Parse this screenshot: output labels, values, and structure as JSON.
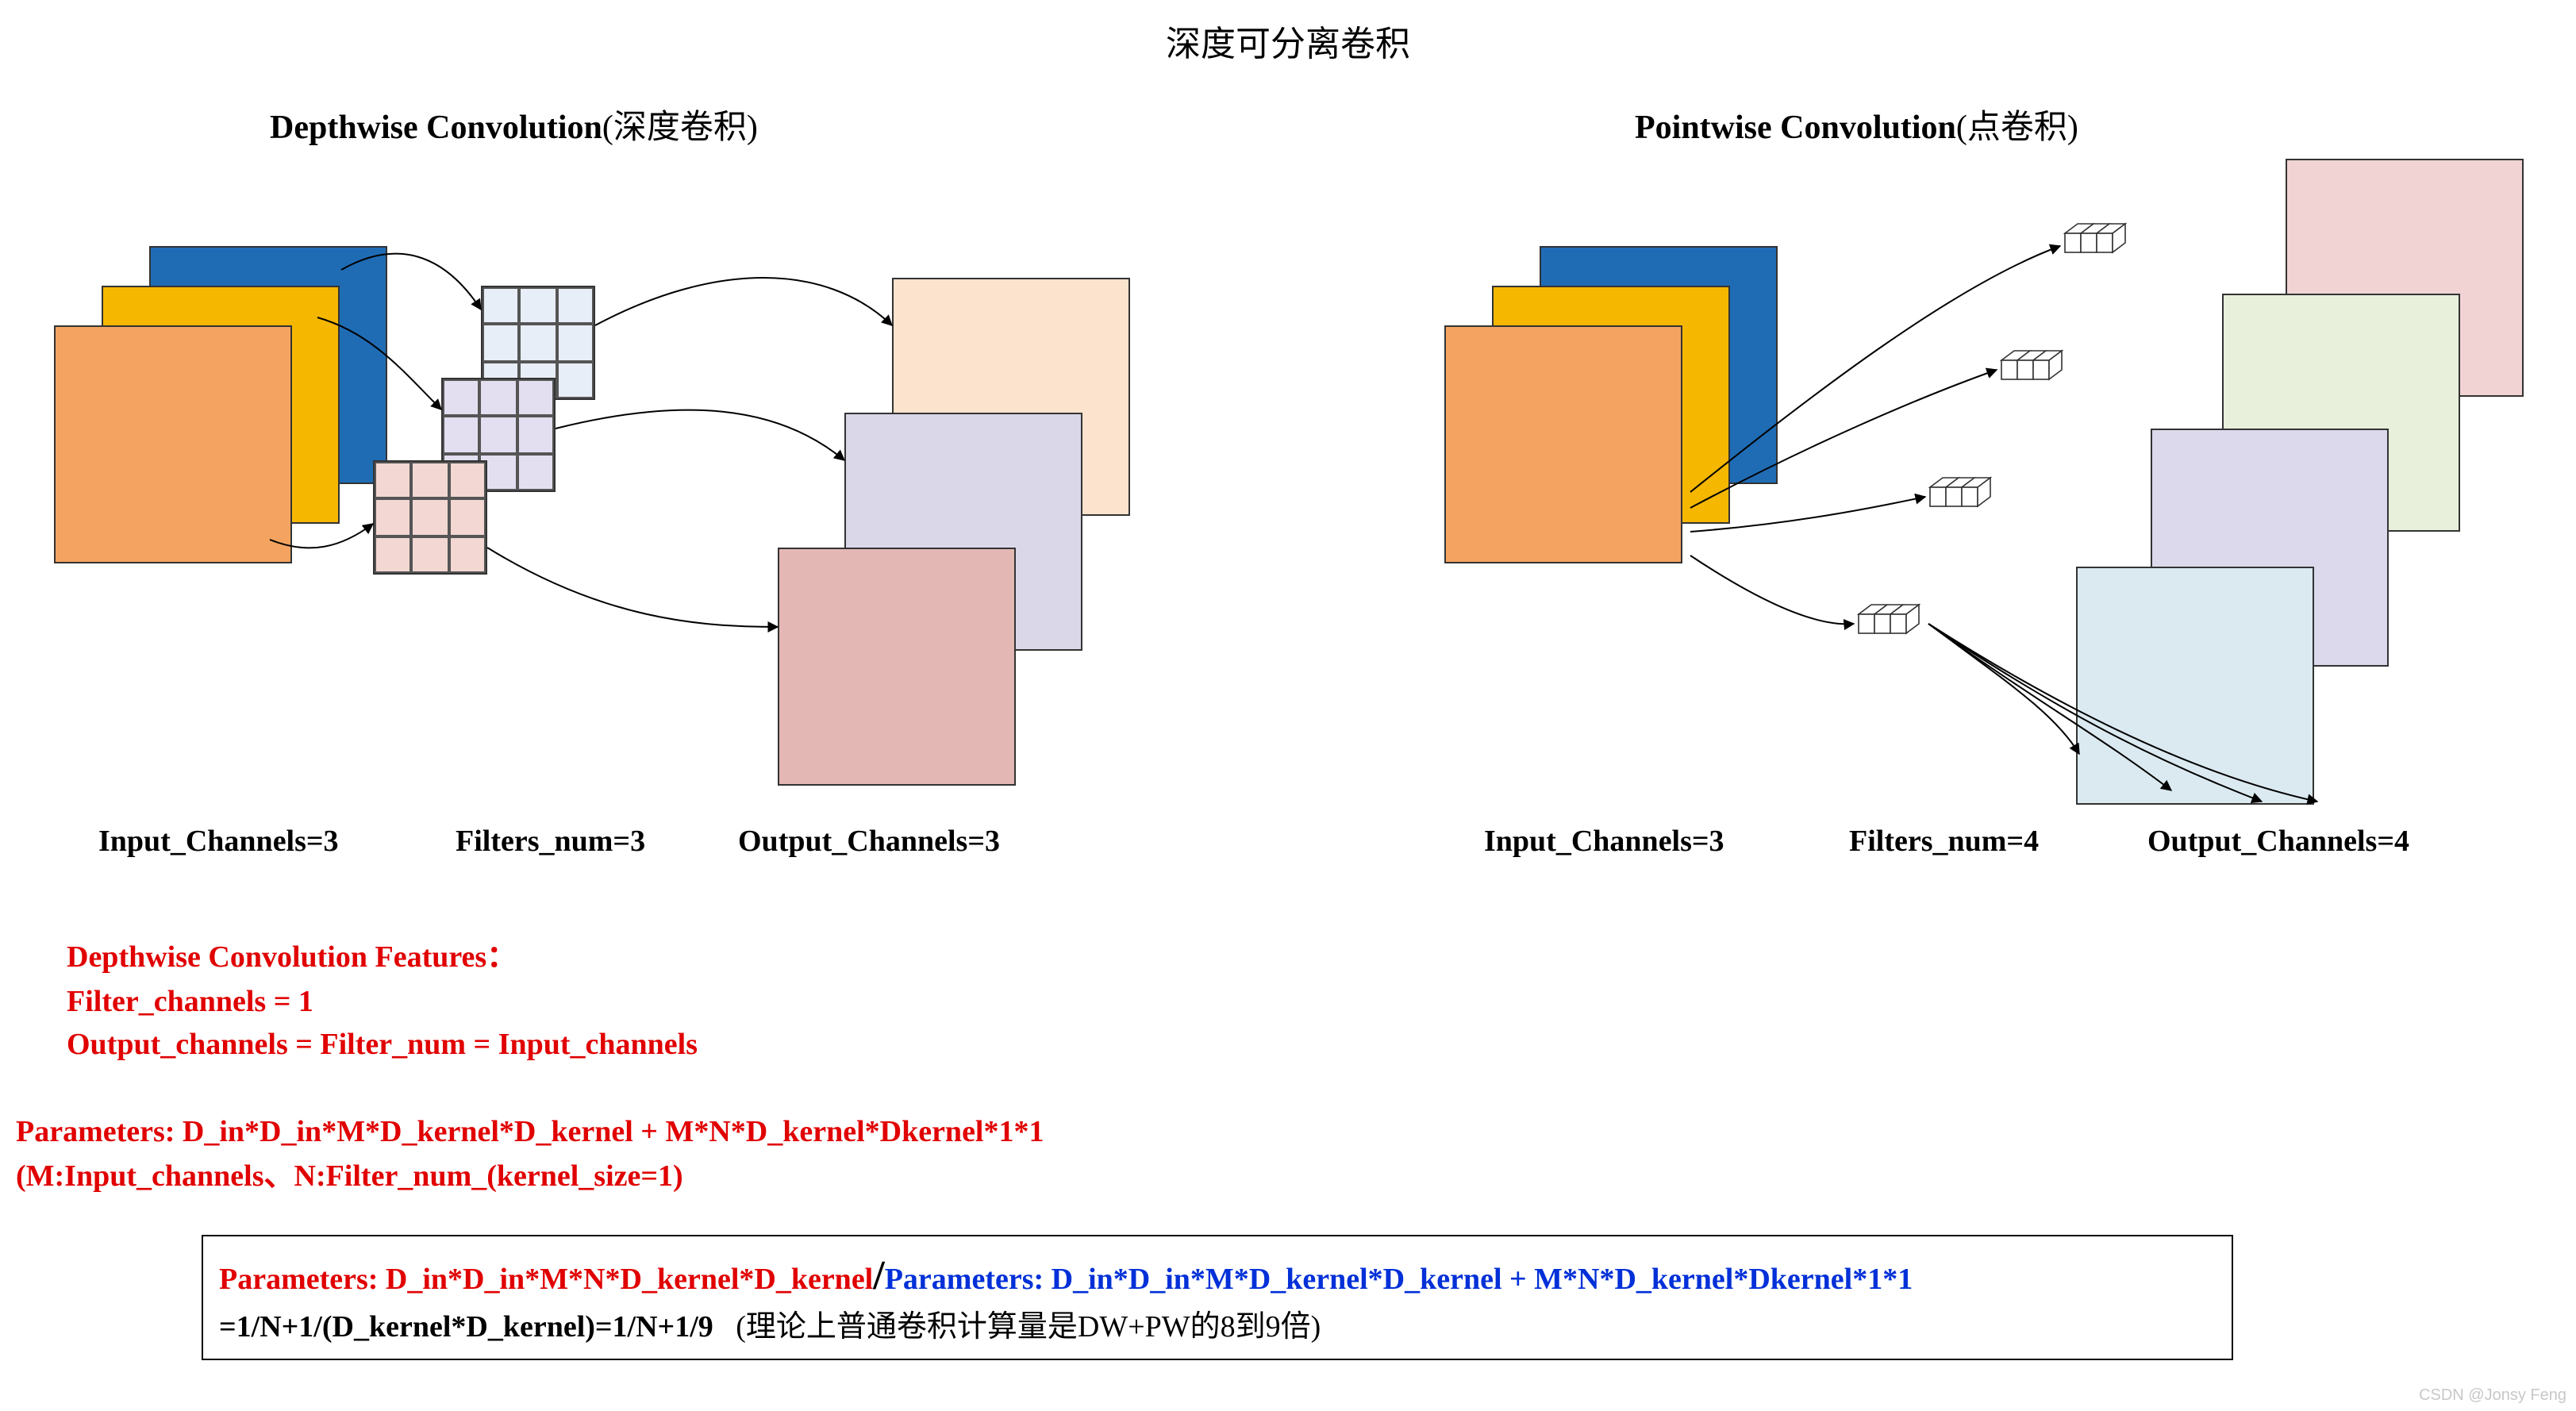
{
  "title": "深度可分离卷积",
  "depthwise": {
    "heading_bold": "Depthwise Convolution",
    "heading_cn": "(深度卷积)",
    "input_label": "Input_Channels=3",
    "filters_label": "Filters_num=3",
    "output_label": "Output_Channels=3"
  },
  "pointwise": {
    "heading_bold": "Pointwise Convolution",
    "heading_cn": "(点卷积)",
    "input_label": "Input_Channels=3",
    "filters_label": "Filters_num=4",
    "output_label": "Output_Channels=4"
  },
  "features": {
    "l1": "Depthwise Convolution Features：",
    "l2": "Filter_channels = 1",
    "l3": "Output_channels = Filter_num = Input_channels"
  },
  "params": {
    "l1": "Parameters: D_in*D_in*M*D_kernel*D_kernel + M*N*D_kernel*Dkernel*1*1",
    "l2": "(M:Input_channels、N:Filter_num_(kernel_size=1)"
  },
  "ratio": {
    "red": "Parameters: D_in*D_in*M*N*D_kernel*D_kernel",
    "slash": "/",
    "blue": "Parameters: D_in*D_in*M*D_kernel*D_kernel + M*N*D_kernel*Dkernel*1*1",
    "line2_pre": "=1/N+1/(D_kernel*D_kernel)=1/N+1/9",
    "line2_note": "(理论上普通卷积计算量是DW+PW的8到9倍)"
  },
  "watermark": "CSDN @Jonsy Feng"
}
